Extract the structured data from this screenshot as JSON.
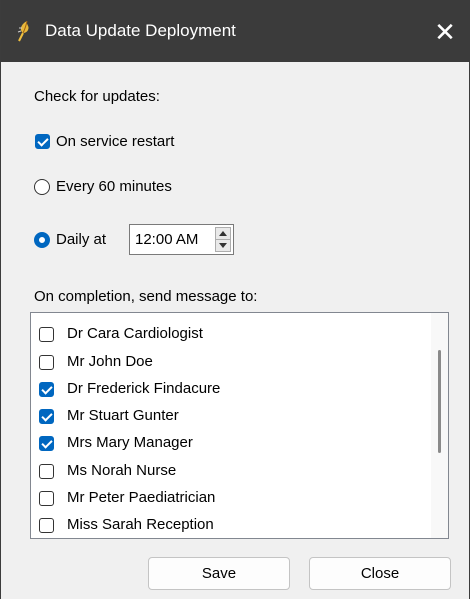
{
  "window": {
    "title": "Data Update Deployment",
    "close_glyph": "✕"
  },
  "check": {
    "heading": "Check for updates:",
    "on_restart": {
      "label": "On service restart",
      "checked": true
    },
    "every": {
      "label": "Every 60 minutes",
      "selected": false
    },
    "daily": {
      "label": "Daily at",
      "selected": true,
      "time": "12:00 AM"
    }
  },
  "completion": {
    "heading": "On completion, send message to:",
    "recipients": [
      {
        "label": "Dr Cara Cardiologist",
        "checked": false
      },
      {
        "label": "Mr John Doe",
        "checked": false
      },
      {
        "label": "Dr Frederick Findacure",
        "checked": true
      },
      {
        "label": "Mr Stuart Gunter",
        "checked": true
      },
      {
        "label": "Mrs Mary Manager",
        "checked": true
      },
      {
        "label": "Ms Norah Nurse",
        "checked": false
      },
      {
        "label": "Mr Peter Paediatrician",
        "checked": false
      },
      {
        "label": "Miss Sarah Reception",
        "checked": false
      }
    ]
  },
  "buttons": {
    "save": "Save",
    "close": "Close"
  },
  "colors": {
    "accent": "#0067c0",
    "titlebar": "#3b3b3b"
  }
}
